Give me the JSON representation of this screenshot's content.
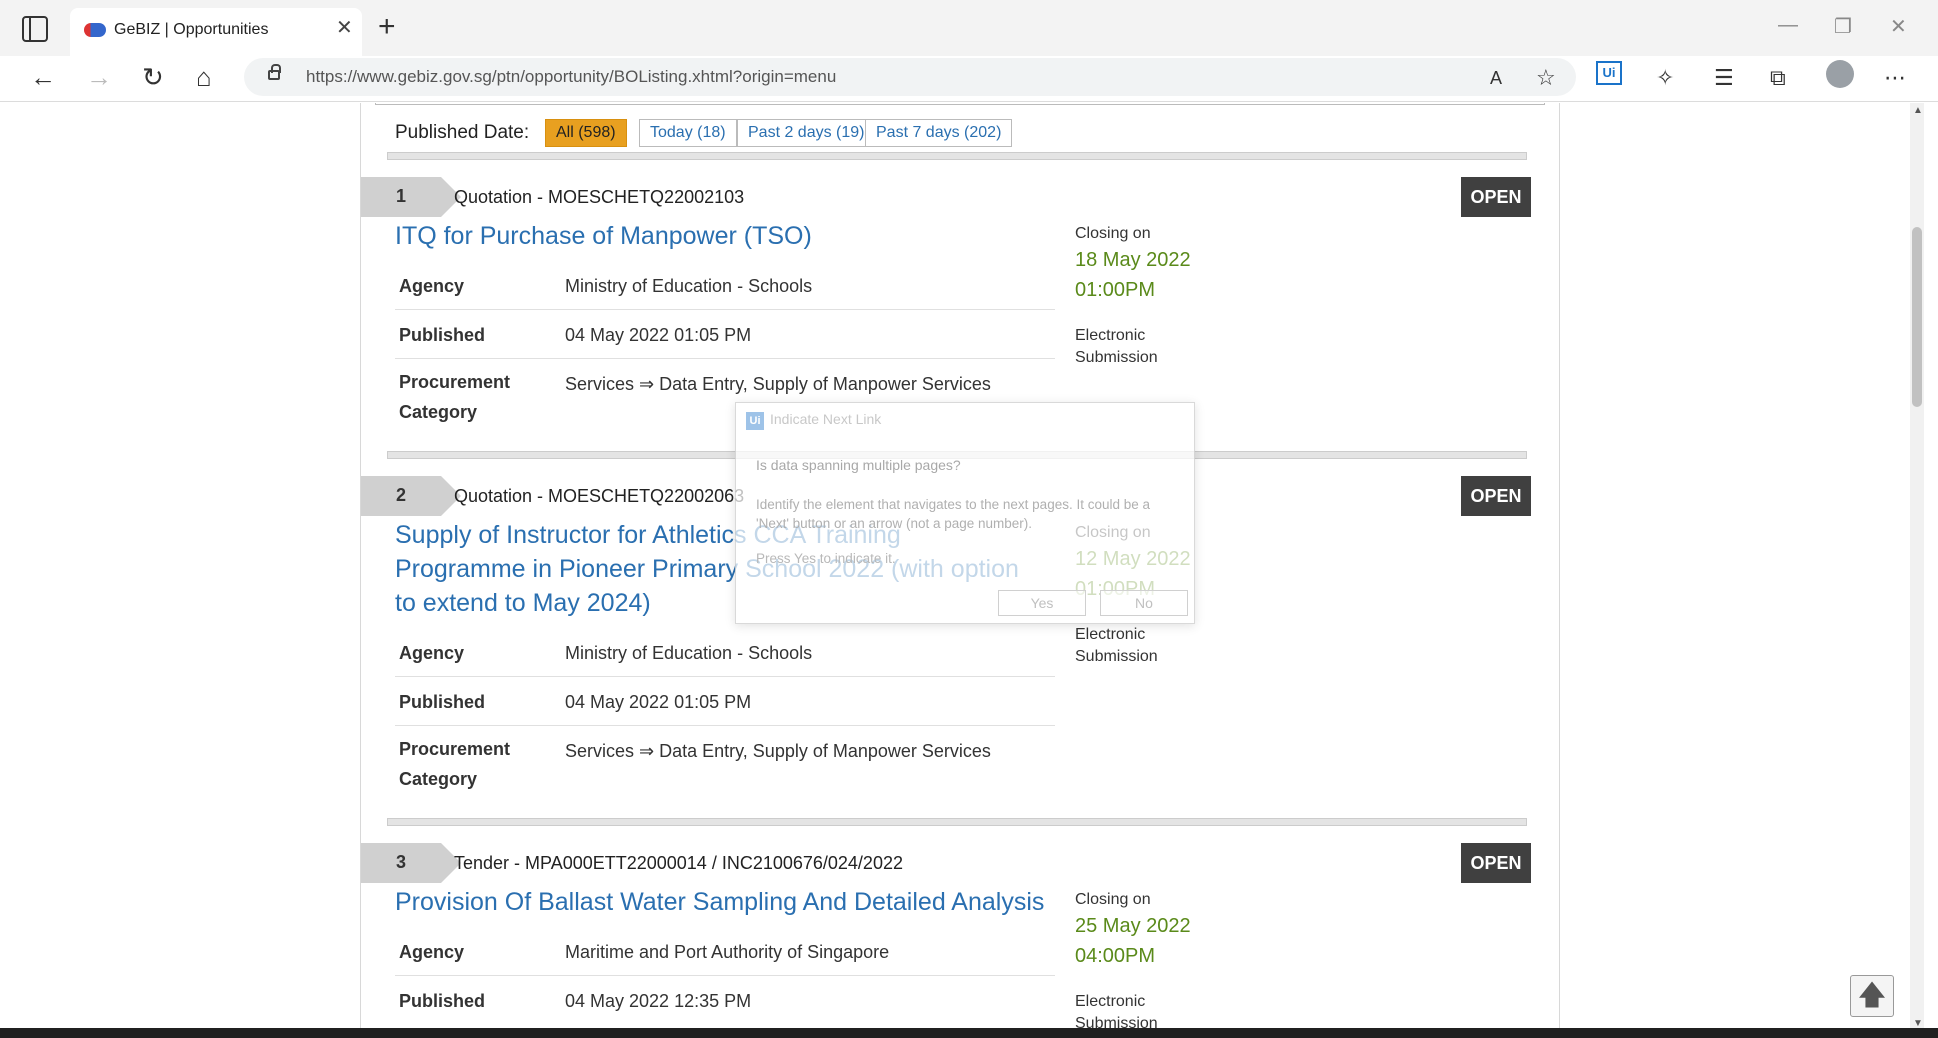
{
  "browser": {
    "tab_title": "GeBIZ | Opportunities",
    "tab_close": "✕",
    "new_tab": "+",
    "url_host": "https://www.gebiz.gov.sg",
    "url_path": "/ptn/opportunity/BOListing.xhtml?origin=menu",
    "win_minimize": "—",
    "win_restore": "❐",
    "win_close": "✕",
    "nav_back": "←",
    "nav_forward": "→",
    "nav_refresh": "↻",
    "nav_home": "⌂",
    "read_aloud": "A",
    "fav_add": "☆",
    "extension_label": "Ui",
    "extensions": "✧",
    "favorites": "☰",
    "collections": "⧉",
    "menu": "⋯"
  },
  "filters": {
    "label": "Published Date:",
    "items": [
      "All (598)",
      "Today (18)",
      "Past 2 days (19)",
      "Past 7 days (202)"
    ],
    "active_index": 0
  },
  "listings": [
    {
      "number": "1",
      "reference": "Quotation - MOESCHETQ22002103",
      "status": "OPEN",
      "title": "ITQ for Purchase of Manpower (TSO)",
      "agency_label": "Agency",
      "agency": "Ministry of Education - Schools",
      "published_label": "Published",
      "published": "04 May 2022 01:05 PM",
      "category_label_1": "Procurement",
      "category_label_2": "Category",
      "category": "Services ⇒ Data Entry, Supply of Manpower Services",
      "closing_label": "Closing on",
      "closing_date": "18 May 2022",
      "closing_time": "01:00PM",
      "submission_1": "Electronic",
      "submission_2": "Submission"
    },
    {
      "number": "2",
      "reference": "Quotation - MOESCHETQ22002063",
      "status": "OPEN",
      "title": "Supply of Instructor for Athletics CCA Training Programme in Pioneer Primary School 2022 (with option to extend to May 2024)",
      "agency_label": "Agency",
      "agency": "Ministry of Education - Schools",
      "published_label": "Published",
      "published": "04 May 2022 01:05 PM",
      "category_label_1": "Procurement",
      "category_label_2": "Category",
      "category": "Services ⇒ Data Entry, Supply of Manpower Services",
      "closing_label": "Closing on",
      "closing_date": "12 May 2022",
      "closing_time": "01:00PM",
      "submission_1": "Electronic",
      "submission_2": "Submission"
    },
    {
      "number": "3",
      "reference": "Tender - MPA000ETT22000014 / INC2100676/024/2022",
      "status": "OPEN",
      "title": "Provision Of Ballast Water Sampling And Detailed Analysis",
      "agency_label": "Agency",
      "agency": "Maritime and Port Authority of Singapore",
      "published_label": "Published",
      "published": "04 May 2022 12:35 PM",
      "closing_label": "Closing on",
      "closing_date": "25 May 2022",
      "closing_time": "04:00PM",
      "submission_1": "Electronic",
      "submission_2": "Submission"
    }
  ],
  "dialog": {
    "icon": "Ui",
    "title": "Indicate Next Link",
    "question": "Is data spanning multiple pages?",
    "body": "Identify the element that navigates to the next pages. It could be a 'Next' button or an arrow (not a page number).",
    "press": "Press Yes to indicate it.",
    "yes": "Yes",
    "no": "No"
  },
  "scroll_to_top": "🡅",
  "scroll_up_arrow": "▲",
  "scroll_down_arrow": "▼"
}
